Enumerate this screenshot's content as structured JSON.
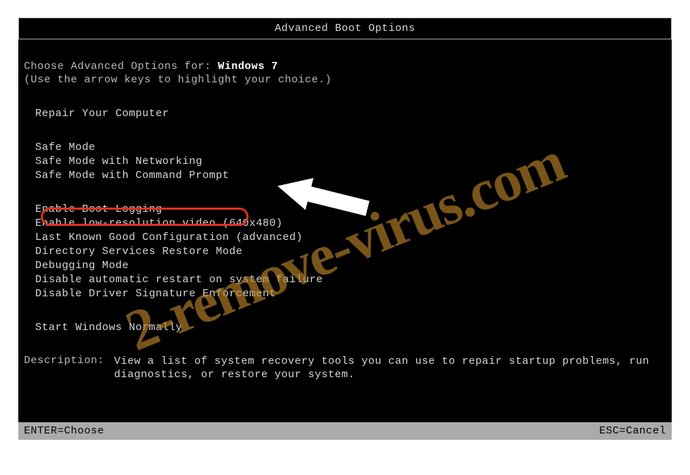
{
  "title": "Advanced Boot Options",
  "choose_prefix": "Choose Advanced Options for: ",
  "os_name": "Windows 7",
  "hint": "(Use the arrow keys to highlight your choice.)",
  "group1": {
    "item": "Repair Your Computer"
  },
  "group2": {
    "items": [
      "Safe Mode",
      "Safe Mode with Networking",
      "Safe Mode with Command Prompt"
    ]
  },
  "group3": {
    "items": [
      "Enable Boot Logging",
      "Enable low-resolution video (640x480)",
      "Last Known Good Configuration (advanced)",
      "Directory Services Restore Mode",
      "Debugging Mode",
      "Disable automatic restart on system failure",
      "Disable Driver Signature Enforcement"
    ]
  },
  "group4": {
    "item": "Start Windows Normally"
  },
  "description": {
    "label": "Description:",
    "text": "View a list of system recovery tools you can use to repair startup problems, run diagnostics, or restore your system."
  },
  "footer": {
    "left": "ENTER=Choose",
    "right": "ESC=Cancel"
  },
  "watermark": "2-remove-virus.com",
  "annotation": {
    "highlight_target": "Safe Mode with Command Prompt"
  }
}
